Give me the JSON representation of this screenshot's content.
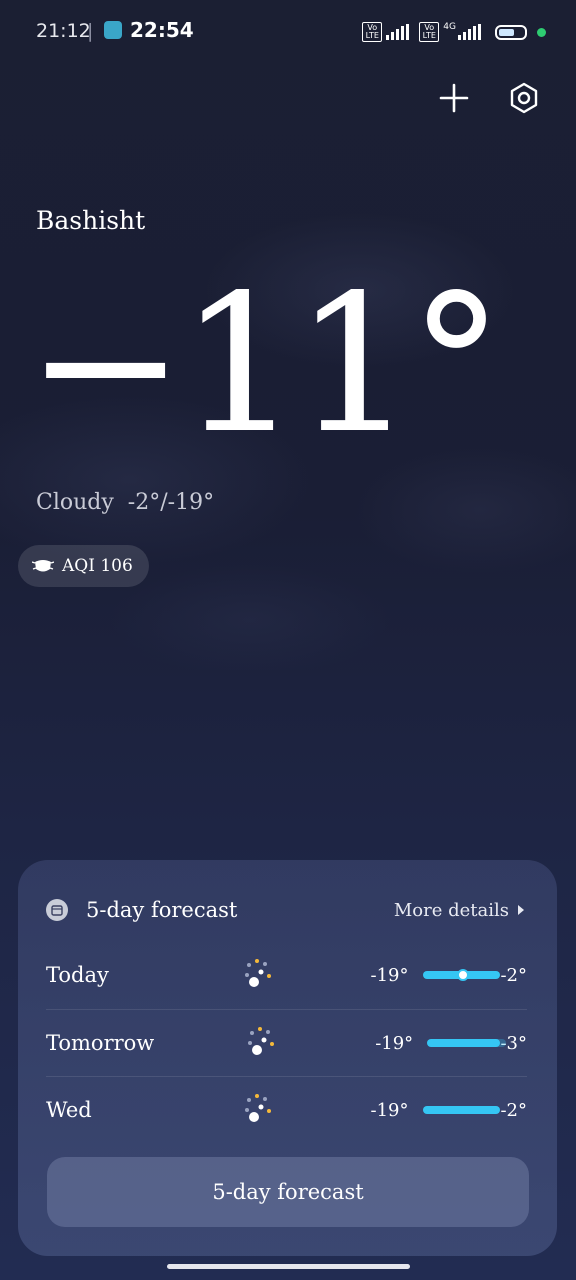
{
  "status_bar": {
    "time_small": "21:12",
    "separator": "|",
    "time_large": "22:54",
    "volte_1": "Vo LTE",
    "volte_2": "Vo LTE",
    "network_type": "4G",
    "battery_percent": "69"
  },
  "header": {
    "icons": [
      "plus-icon",
      "settings-icon"
    ]
  },
  "location": {
    "city": "Bashisht"
  },
  "current": {
    "temperature": "−11°",
    "condition": "Cloudy",
    "range": "-2°/-19°",
    "aqi_label": "AQI 106"
  },
  "forecast_card": {
    "title": "5-day forecast",
    "more_details": "More details",
    "days": [
      {
        "day": "Today",
        "low": "-19°",
        "high": "-2°",
        "icon": "snow-night-icon"
      },
      {
        "day": "Tomorrow",
        "low": "-19°",
        "high": "-3°",
        "icon": "snow-night-icon"
      },
      {
        "day": "Wed",
        "low": "-19°",
        "high": "-2°",
        "icon": "snow-night-icon"
      }
    ],
    "button_label": "5-day forecast"
  },
  "colors": {
    "accent_bar": "#35c6f4",
    "background": "#1b1f33",
    "status_dot": "#2ecc71"
  }
}
